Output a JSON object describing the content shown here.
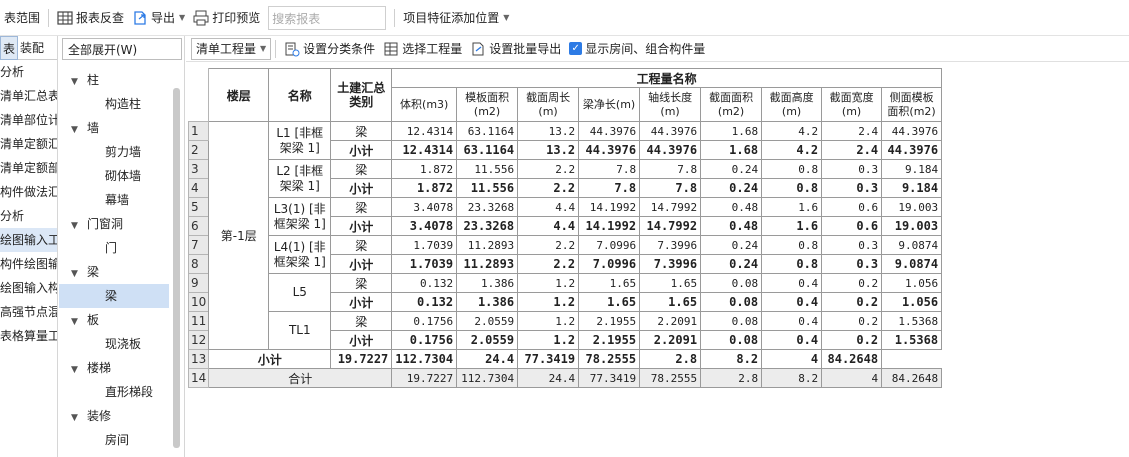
{
  "toolbar": {
    "scope_label": "表范围",
    "report_check_label": "报表反查",
    "export_label": "导出",
    "print_preview_label": "打印预览",
    "search_placeholder": "搜索报表",
    "item_feature_label": "项目特征添加位置"
  },
  "left_tabs": {
    "tab1": "表",
    "tab2": "装配",
    "items": [
      "分析",
      "清单汇总表",
      "清单部位计",
      "清单定额汇",
      "清单定额部",
      "构件做法汇",
      "分析",
      "绘图输入工",
      "构件绘图输",
      "绘图输入构",
      "高强节点混",
      "表格算量工"
    ],
    "selected_index": 7
  },
  "tree_panel": {
    "expand_all": "全部展开(W)",
    "nodes": [
      {
        "label": "柱",
        "children": [
          "构造柱"
        ]
      },
      {
        "label": "墙",
        "children": [
          "剪力墙",
          "砌体墙",
          "幕墙"
        ]
      },
      {
        "label": "门窗洞",
        "children": [
          "门"
        ]
      },
      {
        "label": "梁",
        "children": [
          "梁"
        ]
      },
      {
        "label": "板",
        "children": [
          "现浇板"
        ]
      },
      {
        "label": "楼梯",
        "children": [
          "直形梯段"
        ]
      },
      {
        "label": "装修",
        "children": [
          "房间"
        ]
      }
    ],
    "selected_child": "梁"
  },
  "toolbar2": {
    "quantity_select": "清单工程量",
    "set_category": "设置分类条件",
    "select_quantity": "选择工程量",
    "batch_export": "设置批量导出",
    "show_room": "显示房间、组合构件量"
  },
  "table": {
    "col_floor": "楼层",
    "col_name": "名称",
    "col_category": "土建汇总类别",
    "group_header": "工程量名称",
    "quantity_headers": [
      "体积(m3)",
      "模板面积(m2)",
      "截面周长(m)",
      "梁净长(m)",
      "轴线长度(m)",
      "截面面积(m2)",
      "截面高度(m)",
      "截面宽度(m)",
      "侧面模板面积(m2)"
    ],
    "floor": "第-1层",
    "groups": [
      {
        "name": "L1 [非框架梁 1]",
        "rows": [
          [
            "梁",
            "12.4314",
            "63.1164",
            "13.2",
            "44.3976",
            "44.3976",
            "1.68",
            "4.2",
            "2.4",
            "44.3976"
          ],
          [
            "小计",
            "12.4314",
            "63.1164",
            "13.2",
            "44.3976",
            "44.3976",
            "1.68",
            "4.2",
            "2.4",
            "44.3976"
          ]
        ]
      },
      {
        "name": "L2 [非框架梁 1]",
        "rows": [
          [
            "梁",
            "1.872",
            "11.556",
            "2.2",
            "7.8",
            "7.8",
            "0.24",
            "0.8",
            "0.3",
            "9.184"
          ],
          [
            "小计",
            "1.872",
            "11.556",
            "2.2",
            "7.8",
            "7.8",
            "0.24",
            "0.8",
            "0.3",
            "9.184"
          ]
        ]
      },
      {
        "name": "L3(1) [非框架梁 1]",
        "rows": [
          [
            "梁",
            "3.4078",
            "23.3268",
            "4.4",
            "14.1992",
            "14.7992",
            "0.48",
            "1.6",
            "0.6",
            "19.003"
          ],
          [
            "小计",
            "3.4078",
            "23.3268",
            "4.4",
            "14.1992",
            "14.7992",
            "0.48",
            "1.6",
            "0.6",
            "19.003"
          ]
        ]
      },
      {
        "name": "L4(1) [非框架梁 1]",
        "rows": [
          [
            "梁",
            "1.7039",
            "11.2893",
            "2.2",
            "7.0996",
            "7.3996",
            "0.24",
            "0.8",
            "0.3",
            "9.0874"
          ],
          [
            "小计",
            "1.7039",
            "11.2893",
            "2.2",
            "7.0996",
            "7.3996",
            "0.24",
            "0.8",
            "0.3",
            "9.0874"
          ]
        ]
      },
      {
        "name": "L5",
        "rows": [
          [
            "梁",
            "0.132",
            "1.386",
            "1.2",
            "1.65",
            "1.65",
            "0.08",
            "0.4",
            "0.2",
            "1.056"
          ],
          [
            "小计",
            "0.132",
            "1.386",
            "1.2",
            "1.65",
            "1.65",
            "0.08",
            "0.4",
            "0.2",
            "1.056"
          ]
        ]
      },
      {
        "name": "TL1",
        "rows": [
          [
            "梁",
            "0.1756",
            "2.0559",
            "1.2",
            "2.1955",
            "2.2091",
            "0.08",
            "0.4",
            "0.2",
            "1.5368"
          ],
          [
            "小计",
            "0.1756",
            "2.0559",
            "1.2",
            "2.1955",
            "2.2091",
            "0.08",
            "0.4",
            "0.2",
            "1.5368"
          ]
        ]
      }
    ],
    "floor_subtotal": {
      "label": "小计",
      "values": [
        "19.7227",
        "112.7304",
        "24.4",
        "77.3419",
        "78.2555",
        "2.8",
        "8.2",
        "4",
        "84.2648"
      ]
    },
    "grand_total": {
      "label": "合计",
      "values": [
        "19.7227",
        "112.7304",
        "24.4",
        "77.3419",
        "78.2555",
        "2.8",
        "8.2",
        "4",
        "84.2648"
      ]
    },
    "row_numbers": [
      "1",
      "2",
      "3",
      "4",
      "5",
      "6",
      "7",
      "8",
      "9",
      "10",
      "11",
      "12",
      "13",
      "14"
    ]
  },
  "colors": {
    "accent": "#2d7be5",
    "selected_bg": "#cfe0f5",
    "total_bg": "#ececec"
  }
}
